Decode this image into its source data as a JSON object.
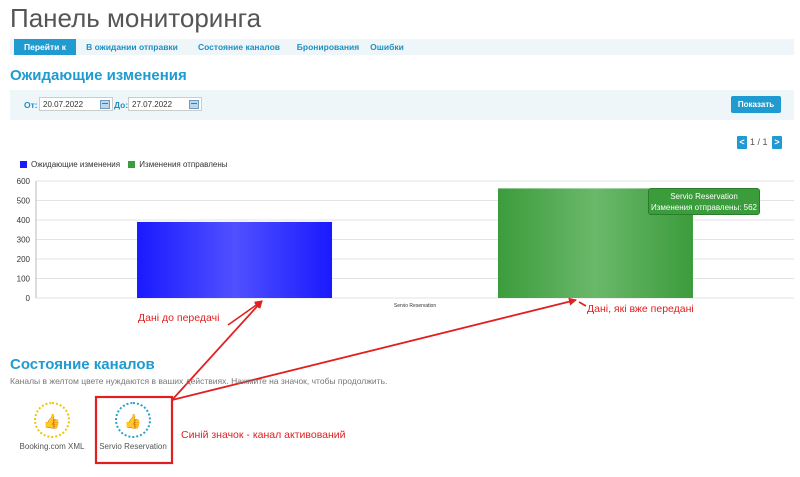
{
  "page_title": "Панель мониторинга",
  "nav": {
    "tabs": [
      {
        "label": "Перейти к",
        "active": true
      },
      {
        "label": "В ожидании отправки",
        "active": false
      },
      {
        "label": "Состояние каналов",
        "active": false
      },
      {
        "label": "Бронирования",
        "active": false
      },
      {
        "label": "Ошибки",
        "active": false
      }
    ]
  },
  "pending": {
    "title": "Ожидающие изменения",
    "from_label": "От:",
    "from_value": "20.07.2022",
    "to_label": "До:",
    "to_value": "27.07.2022",
    "show_button": "Показать",
    "pagination": {
      "prev": "<",
      "text": "1 / 1",
      "next": ">"
    }
  },
  "chart_data": {
    "type": "bar",
    "categories": [
      "Servio Reservation"
    ],
    "series": [
      {
        "name": "Ожидающие изменения",
        "values": [
          390
        ],
        "color": "#1a1aff"
      },
      {
        "name": "Изменения отправлены",
        "values": [
          562
        ],
        "color": "#3c9c3c"
      }
    ],
    "ylim": [
      0,
      600
    ],
    "yticks": [
      "0",
      "100",
      "200",
      "300",
      "400",
      "500",
      "600"
    ],
    "legend": "top-left",
    "grid": true
  },
  "tooltip": {
    "title": "Servio Reservation",
    "text": "Изменения отправлены: 562"
  },
  "annotations": {
    "pending_label": "Дані до передачі",
    "sent_label": "Дані, які вже передані",
    "active_icon_label": "Синій значок - канал активований",
    "color": "#e02020"
  },
  "channels": {
    "title": "Состояние каналов",
    "description": "Каналы в желтом цвете нуждаются в ваших действиях. Нажмите на значок, чтобы продолжить.",
    "items": [
      {
        "label": "Booking.com XML",
        "status": "yellow",
        "icon": "thumbs-up-icon",
        "color": "#f0c20a"
      },
      {
        "label": "Servio Reservation",
        "status": "blue",
        "icon": "thumbs-up-icon",
        "color": "#2a9fd0"
      }
    ]
  }
}
